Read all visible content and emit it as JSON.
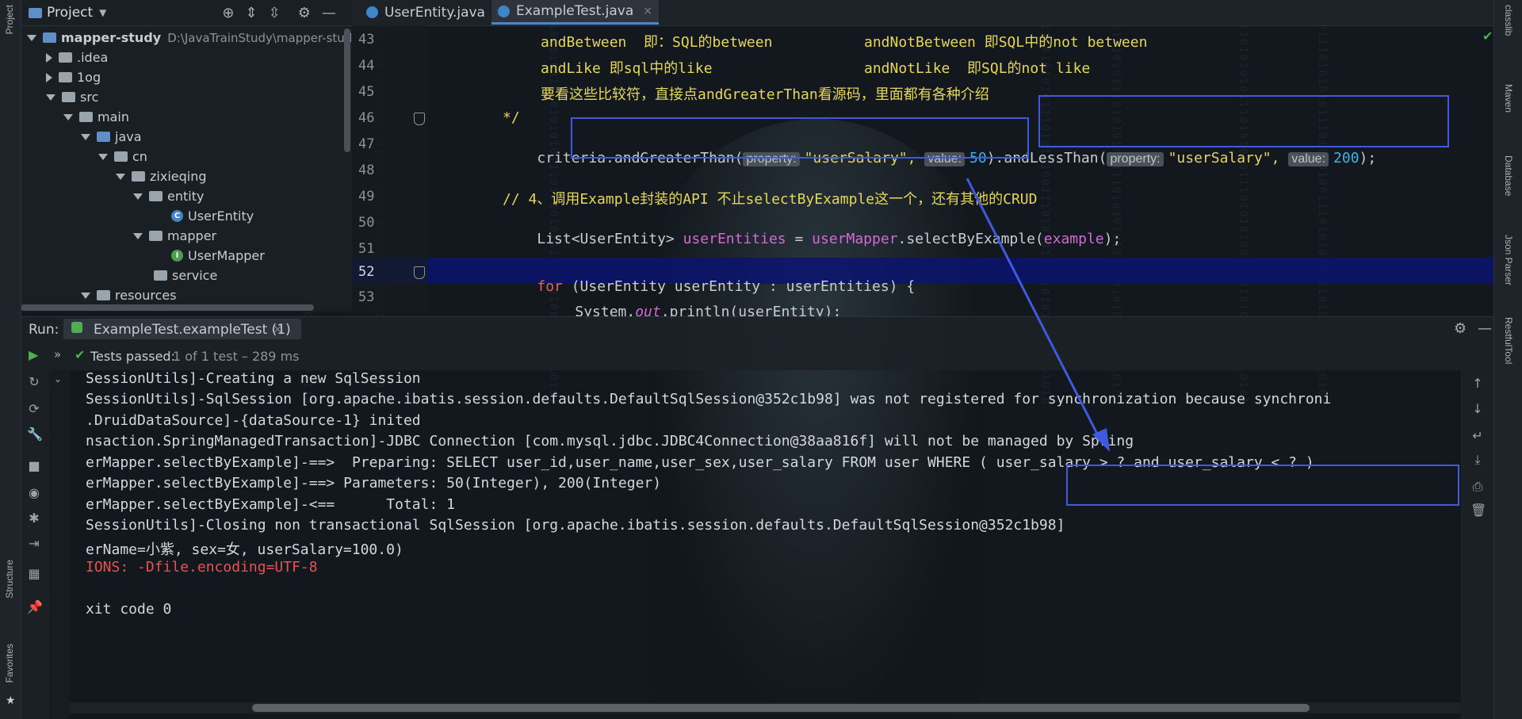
{
  "left_stripe": {
    "project": "Project",
    "structure": "Structure",
    "favorites": "Favorites"
  },
  "right_stripe": {
    "classlib": "classlib",
    "maven": "Maven",
    "database": "Database",
    "json_parser": "Json Parser",
    "restful_tool": "RestfulTool"
  },
  "project_panel": {
    "title": "Project",
    "tree": [
      {
        "label": "mapper-study",
        "path": "D:\\JavaTrainStudy\\mapper-stud"
      },
      {
        "label": ".idea"
      },
      {
        "label": "1og"
      },
      {
        "label": "src"
      },
      {
        "label": "main"
      },
      {
        "label": "java"
      },
      {
        "label": "cn"
      },
      {
        "label": "zixieqing"
      },
      {
        "label": "entity"
      },
      {
        "label": "UserEntity"
      },
      {
        "label": "mapper"
      },
      {
        "label": "UserMapper"
      },
      {
        "label": "service"
      },
      {
        "label": "resources"
      }
    ]
  },
  "tabs": [
    {
      "label": "UserEntity.java",
      "close": "×"
    },
    {
      "label": "ExampleTest.java",
      "close": "×"
    }
  ],
  "editor": {
    "line_numbers": [
      "43",
      "44",
      "45",
      "46",
      "47",
      "48",
      "49",
      "50",
      "51",
      "52",
      "53"
    ],
    "l43a": "andBetween  即：SQL的between",
    "l43b": "andNotBetween 即SQL中的not between",
    "l44a": "andLike 即sql中的like",
    "l44b": "andNotLike  即SQL的not like",
    "l45": "要看这些比较符，直接点andGreaterThan看源码，里面都有各种介绍",
    "l46": "*/",
    "l47_pre": "criteria.andGreaterThan(",
    "l47_hint1": "property:",
    "l47_str1": "\"userSalary\",",
    "l47_hint2": "value:",
    "l47_num1": "50",
    "l47_mid": ").andLessThan(",
    "l47_hint3": "property:",
    "l47_str2": "\"userSalary\",",
    "l47_hint4": "value:",
    "l47_num2": "200",
    "l47_end": ");",
    "l49": "// 4、调用Example封装的API 不止selectByExample这一个，还有其他的CRUD",
    "l50_a": "List<UserEntity> ",
    "l50_b": "userEntities",
    "l50_c": " = ",
    "l50_d": "userMapper",
    "l50_e": ".selectByExample(",
    "l50_f": "example",
    "l50_g": ");",
    "l52_kw": "for",
    "l52_rest": " (UserEntity userEntity : userEntities) {",
    "l53_a": "System.",
    "l53_b": "out",
    "l53_c": ".println(userEntity);"
  },
  "run": {
    "label": "Run:",
    "config": "ExampleTest.exampleTest (1)",
    "close": "×",
    "status": "Tests passed:",
    "count": "1 of 1 test – 289 ms"
  },
  "console": [
    "SessionUtils]-Creating a new SqlSession",
    "SessionUtils]-SqlSession [org.apache.ibatis.session.defaults.DefaultSqlSession@352c1b98] was not registered for synchronization because synchroni",
    ".DruidDataSource]-{dataSource-1} inited",
    "nsaction.SpringManagedTransaction]-JDBC Connection [com.mysql.jdbc.JDBC4Connection@38aa816f] will not be managed by Spring",
    "erMapper.selectByExample]-==>  Preparing: SELECT user_id,user_name,user_sex,user_salary FROM user WHERE ( user_salary > ? and user_salary < ? )",
    "erMapper.selectByExample]-==> Parameters: 50(Integer), 200(Integer)",
    "erMapper.selectByExample]-<==      Total: 1",
    "SessionUtils]-Closing non transactional SqlSession [org.apache.ibatis.session.defaults.DefaultSqlSession@352c1b98]",
    "erName=小紫, sex=女, userSalary=100.0)",
    "IONS: -Dfile.encoding=UTF-8",
    "",
    "xit code 0"
  ],
  "colors": {
    "annotation": "#3f59e0",
    "current_line": "#0a146e",
    "error": "#e65350"
  }
}
